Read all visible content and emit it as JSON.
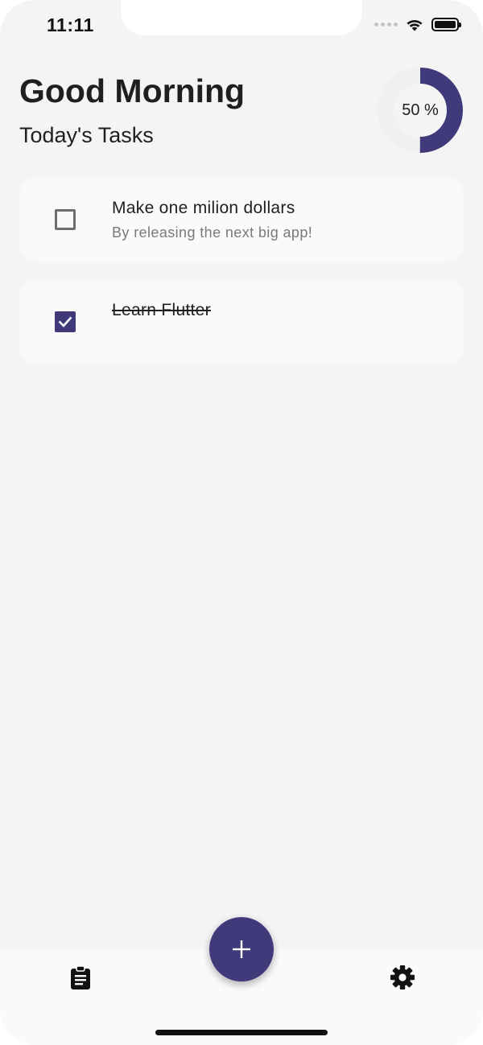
{
  "status_bar": {
    "time": "11:11"
  },
  "header": {
    "greeting": "Good Morning",
    "subtitle": "Today's Tasks"
  },
  "progress": {
    "label": "50 %",
    "value": 0.5,
    "color": "#40397a",
    "track_color": "#f0f0f0"
  },
  "tasks": [
    {
      "title": "Make one milion dollars",
      "description": "By releasing the next big app!",
      "completed": false
    },
    {
      "title": "Learn Flutter",
      "description": "",
      "completed": true
    }
  ],
  "nav": {
    "left_icon": "clipboard-list-icon",
    "right_icon": "gear-icon",
    "fab_icon": "plus-icon"
  },
  "colors": {
    "accent": "#40397a",
    "background": "#f4f4f4",
    "card": "#fafafa"
  }
}
